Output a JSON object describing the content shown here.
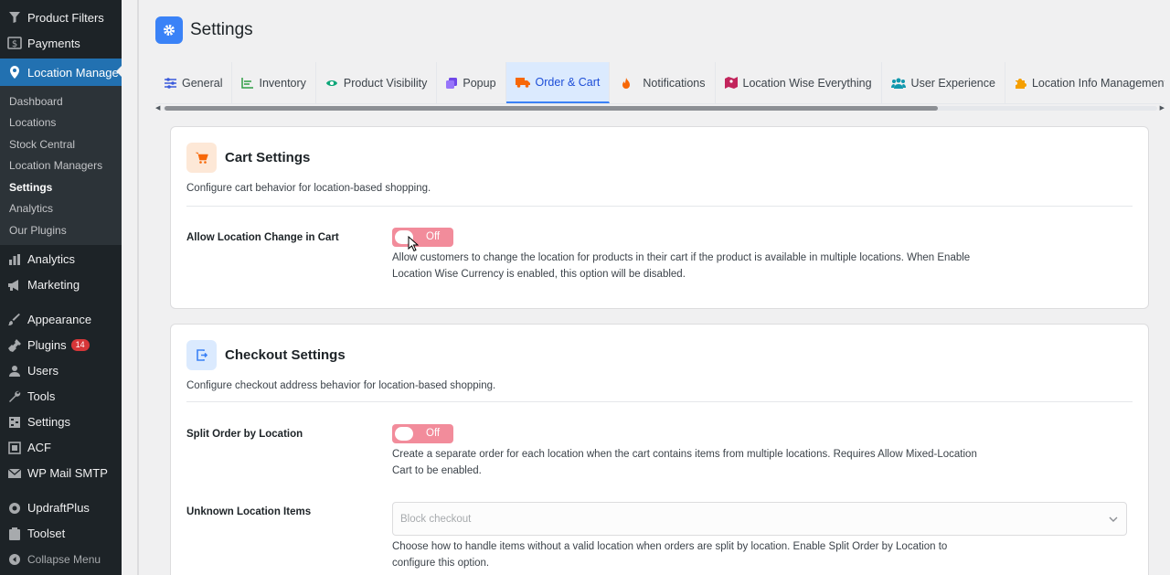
{
  "sidebar": {
    "top_items": [
      {
        "label": "Product Filters",
        "icon": "filter-icon"
      },
      {
        "label": "Payments",
        "icon": "dollar-icon"
      }
    ],
    "active_item": {
      "label": "Location Manage",
      "icon": "location-pin-icon"
    },
    "submenu": [
      "Dashboard",
      "Locations",
      "Stock Central",
      "Location Managers",
      "Settings",
      "Analytics",
      "Our Plugins"
    ],
    "current_submenu": "Settings",
    "group1": [
      {
        "label": "Analytics",
        "icon": "bar-chart-icon"
      },
      {
        "label": "Marketing",
        "icon": "megaphone-icon"
      }
    ],
    "group2": [
      {
        "label": "Appearance",
        "icon": "paintbrush-icon"
      },
      {
        "label": "Plugins",
        "icon": "plug-icon",
        "badge": "14"
      },
      {
        "label": "Users",
        "icon": "users-icon"
      },
      {
        "label": "Tools",
        "icon": "wrench-icon"
      },
      {
        "label": "Settings",
        "icon": "settings-grid-icon"
      },
      {
        "label": "ACF",
        "icon": "acf-icon"
      },
      {
        "label": "WP Mail SMTP",
        "icon": "mail-icon"
      }
    ],
    "group3": [
      {
        "label": "UpdraftPlus",
        "icon": "updraft-icon"
      },
      {
        "label": "Toolset",
        "icon": "toolset-icon"
      }
    ],
    "collapse_label": "Collapse Menu"
  },
  "page": {
    "title": "Settings"
  },
  "tabs": [
    {
      "label": "General",
      "icon": "sliders-icon",
      "color": "#3b5bdb"
    },
    {
      "label": "Inventory",
      "icon": "chart-line-icon",
      "color": "#2f9e44"
    },
    {
      "label": "Product Visibility",
      "icon": "eye-icon",
      "color": "#0ca678"
    },
    {
      "label": "Popup",
      "icon": "layers-icon",
      "color": "#7048e8"
    },
    {
      "label": "Order & Cart",
      "icon": "truck-icon",
      "color": "#f76707",
      "active": true
    },
    {
      "label": "Notifications",
      "icon": "flame-icon",
      "color": "#f76707"
    },
    {
      "label": "Location Wise Everything",
      "icon": "map-icon",
      "color": "#c2255c"
    },
    {
      "label": "User Experience",
      "icon": "users-icon",
      "color": "#1098ad"
    },
    {
      "label": "Location Info Management",
      "icon": "puzzle-icon",
      "color": "#f59f00"
    },
    {
      "label": "",
      "icon": "list-icon",
      "color": "#3b82f6"
    }
  ],
  "cart_settings": {
    "title": "Cart Settings",
    "description": "Configure cart behavior for location-based shopping.",
    "field_label": "Allow Location Change in Cart",
    "toggle_label": "Off",
    "help_line1": "Allow customers to change the location for products in their cart if the product is available in multiple locations. When Enable",
    "help_line2": "Location Wise Currency is enabled, this option will be disabled."
  },
  "checkout_settings": {
    "title": "Checkout Settings",
    "description": "Configure checkout address behavior for location-based shopping.",
    "split_label": "Split Order by Location",
    "split_toggle_label": "Off",
    "split_help_line1": "Create a separate order for each location when the cart contains items from multiple locations. Requires Allow Mixed-Location",
    "split_help_line2": "Cart to be enabled.",
    "unknown_label": "Unknown Location Items",
    "unknown_select_value": "Block checkout",
    "unknown_help_line1": "Choose how to handle items without a valid location when orders are split by location. Enable Split Order by Location to",
    "unknown_help_line2": "configure this option."
  }
}
